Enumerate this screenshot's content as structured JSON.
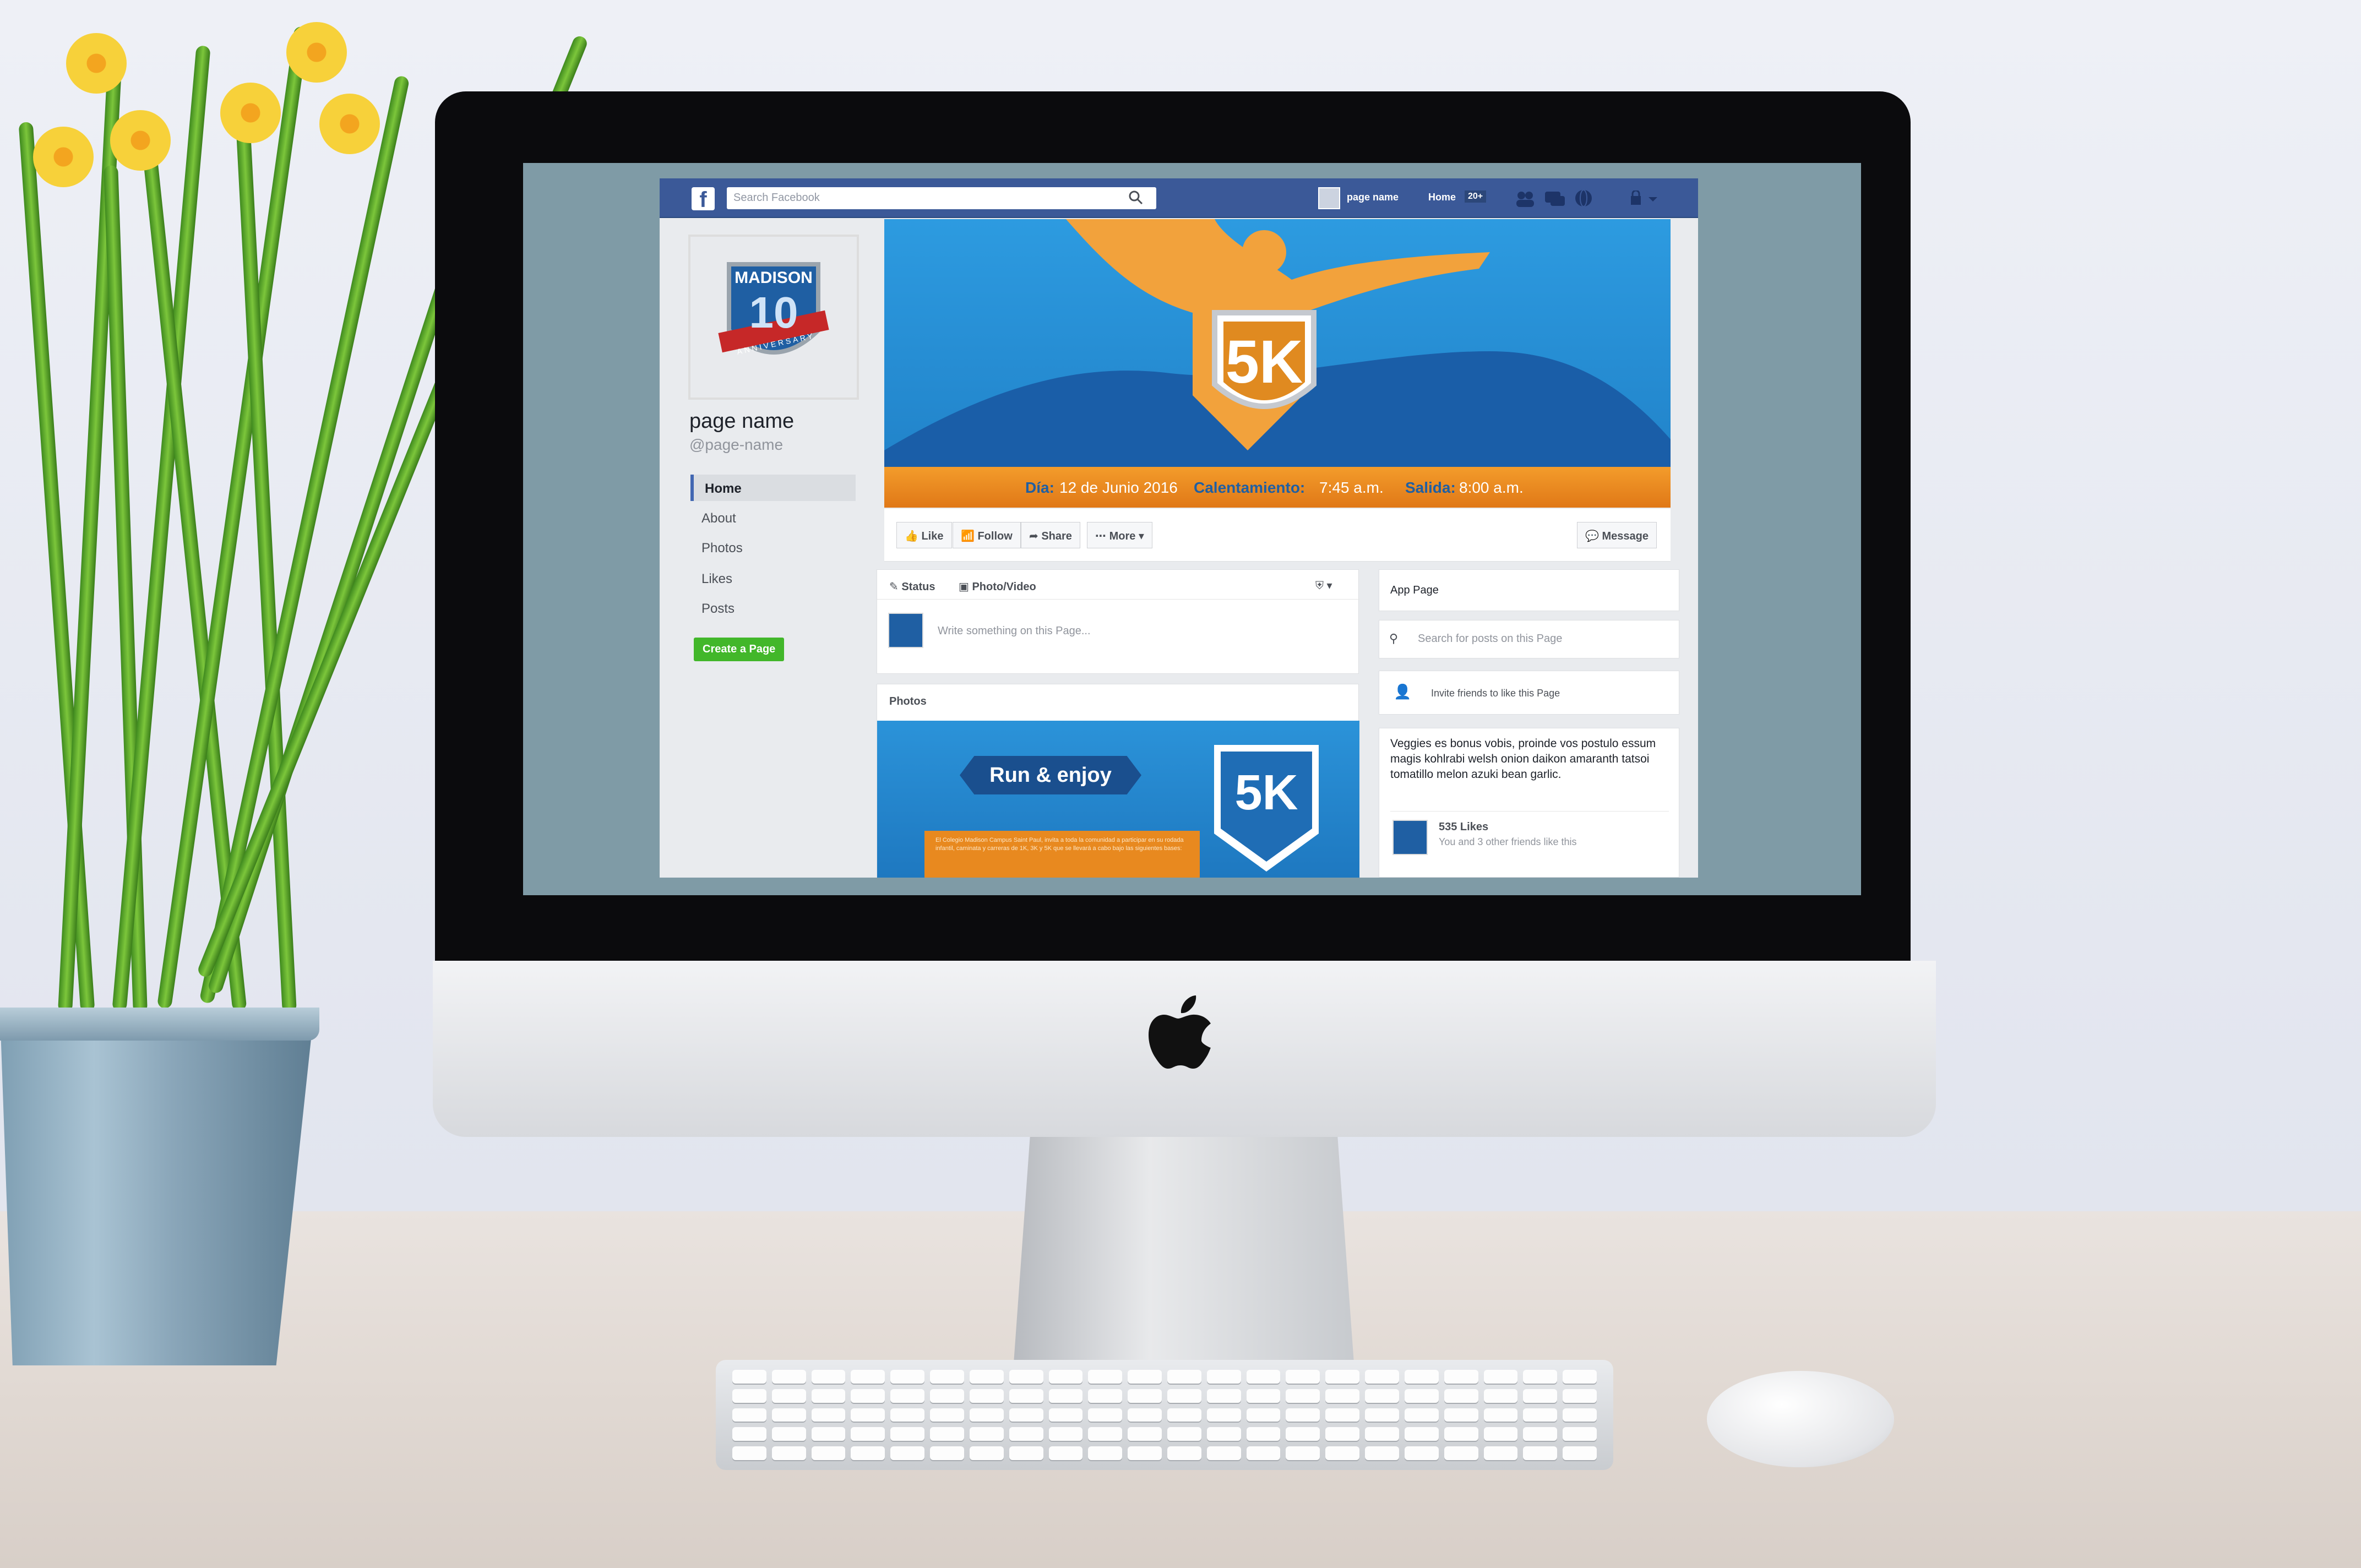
{
  "browser": {
    "search_placeholder": "Search Facebook",
    "profile_label": "page name",
    "home_label": "Home",
    "home_badge": "20+"
  },
  "page": {
    "name": "page name",
    "handle": "@page-name",
    "nav": [
      {
        "label": "Home",
        "active": true
      },
      {
        "label": "About"
      },
      {
        "label": "Photos"
      },
      {
        "label": "Likes"
      },
      {
        "label": "Posts"
      }
    ],
    "create_page": "Create a Page",
    "logo_text": "MADISON",
    "logo_number": "10",
    "logo_ribbon": "ANNIVERSARY"
  },
  "cover": {
    "badge": "5K",
    "dia_label": "Día:",
    "dia_value": "12 de Junio 2016",
    "warmup_label": "Calentamiento:",
    "warmup_value": "7:45 a.m.",
    "start_label": "Salida:",
    "start_value": "8:00 a.m."
  },
  "actions": {
    "like": "Like",
    "follow": "Follow",
    "share": "Share",
    "more": "More",
    "message": "Message"
  },
  "composer": {
    "status": "Status",
    "photo": "Photo/Video",
    "placeholder": "Write something on this Page..."
  },
  "photos": {
    "title": "Photos",
    "banner": "Run & enjoy",
    "badge": "5K",
    "caption": "El Colegio Madison Campus Saint Paul, invita a toda la comunidad a participar en su rodada infantil, caminata y carreras de 1K, 3K y 5K que se llevará a cabo bajo las siguientes bases:"
  },
  "sidebar": {
    "app_page": "App Page",
    "search_placeholder": "Search for posts on this Page",
    "invite": "Invite friends to like this Page",
    "about": "Veggies es bonus vobis, proinde vos postulo essum magis kohlrabi welsh onion daikon amaranth tatsoi tomatillo melon azuki bean garlic.",
    "likes": "535 Likes",
    "likes_sub": "You and 3 other friends like this"
  },
  "colors": {
    "fb_blue": "#3b5998",
    "cover_blue": "#2d9be0",
    "cover_orange": "#e8891f",
    "create_green": "#42b72a"
  },
  "icons": [
    "facebook-icon",
    "search-icon",
    "friends-icon",
    "messages-icon",
    "globe-icon",
    "lock-icon",
    "like-icon",
    "follow-icon",
    "share-icon",
    "more-icon",
    "message-icon",
    "pencil-icon",
    "camera-icon",
    "invite-icon",
    "apple-logo"
  ]
}
